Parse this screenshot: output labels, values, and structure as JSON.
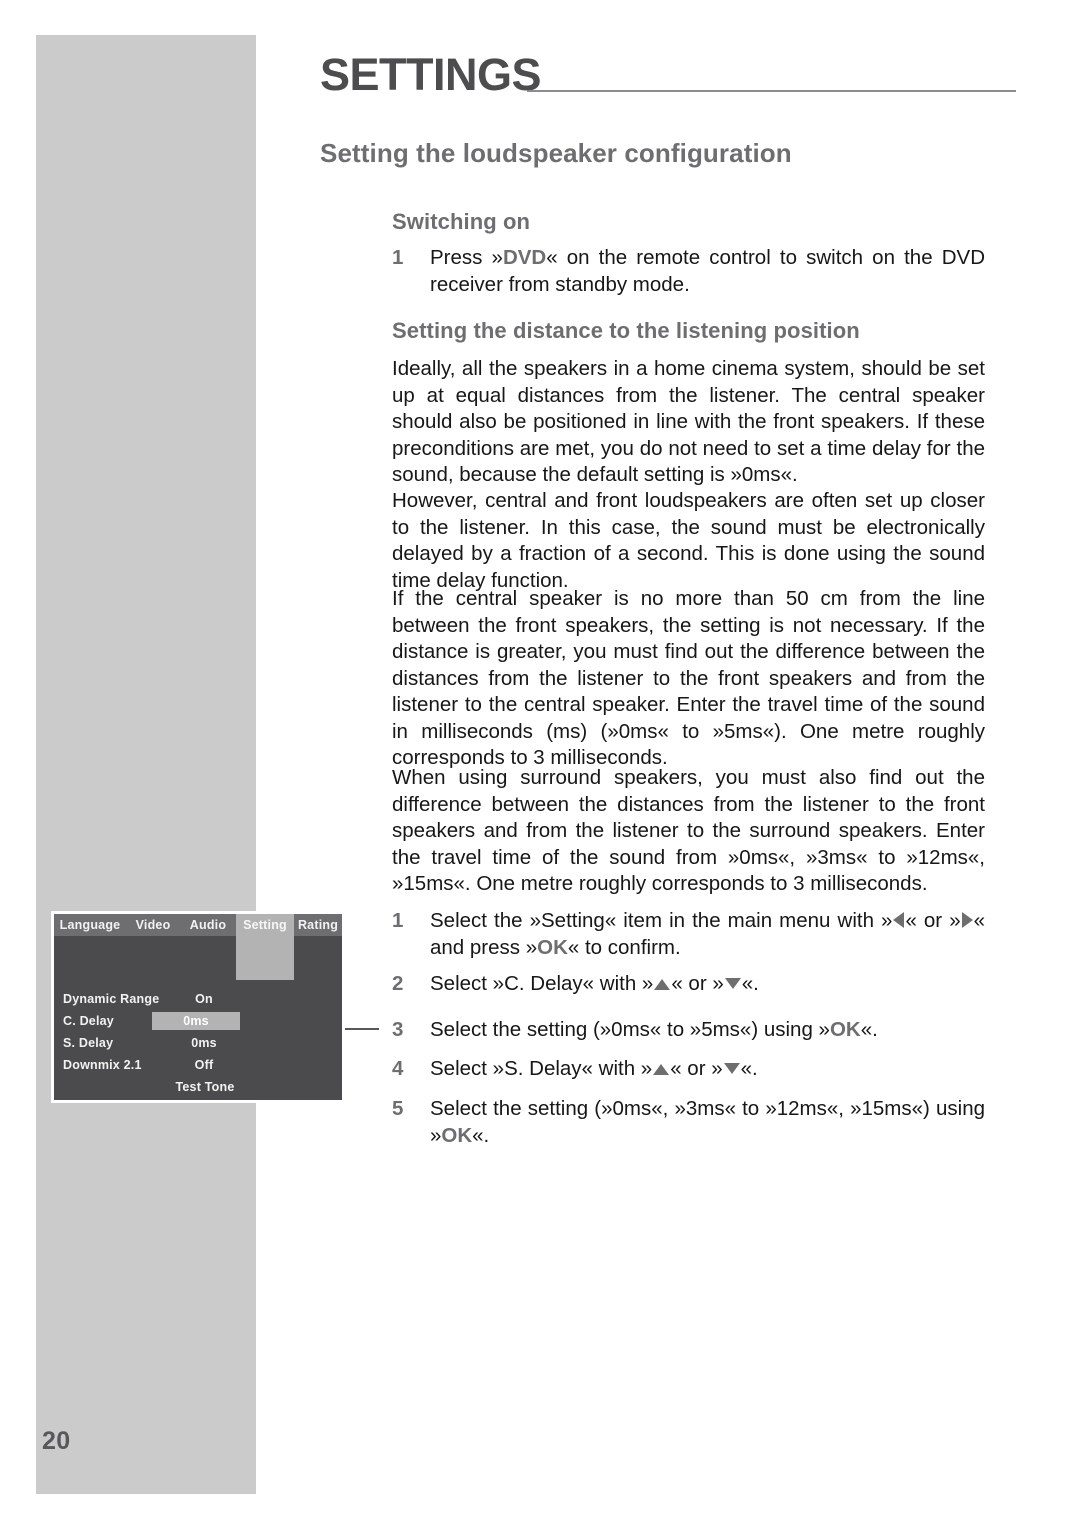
{
  "page": {
    "number": "20",
    "chapter_title": "SETTINGS",
    "section_heading": "Setting the loudspeaker configuration"
  },
  "subsections": {
    "switching_on": {
      "heading": "Switching on",
      "step_number": "1",
      "step_text_prefix": "Press »",
      "step_keyword": "DVD",
      "step_text_suffix": "« on the remote control to switch on the DVD receiver from standby mode."
    },
    "distance": {
      "heading": "Setting the distance to the listening position",
      "paragraphs": [
        "Ideally, all the speakers in a home cinema system, should be set up at equal distances from the listener. The central speaker should also be positioned in line with the front speakers. If these preconditions are met, you do not need to set a time delay for the sound, because the default setting is »0ms«.",
        "However, central and front loudspeakers are often set up closer to the listener. In this case, the sound must be electronically delayed by a fraction of a second. This is done using the sound time delay function.",
        "If the central speaker is no more than 50 cm from the line between the front speakers, the setting is not necessary. If the distance is greater, you must find out the difference between the distances from the listener to the front speakers and from the listener to the central speaker. Enter the travel time of the sound in milliseconds (ms) (»0ms« to »5ms«). One metre roughly corresponds to 3 milliseconds.",
        "When using surround speakers, you must also find out the difference between the distances from the listener to the front speakers and from the listener to the surround speakers. Enter the travel time of the sound  from »0ms«, »3ms« to »12ms«, »15ms«. One metre roughly corresponds to 3 milliseconds."
      ]
    }
  },
  "steps": [
    {
      "number": "1",
      "part1": "Select the »Setting« item in the main menu with »",
      "icon1": "left-arrow-icon",
      "part2": "« or »",
      "icon2": "right-arrow-icon",
      "part3": "« and press »",
      "keyword": "OK",
      "part4": "« to confirm."
    },
    {
      "number": "2",
      "part1": "Select »C. Delay« with »",
      "icon1": "up-arrow-icon",
      "part2": "« or »",
      "icon2": "down-arrow-icon",
      "part3": "«.",
      "keyword": "",
      "part4": ""
    },
    {
      "number": "3",
      "part1": "Select the setting (»0ms« to »5ms«) using »",
      "icon1": "",
      "part2": "",
      "icon2": "",
      "part3": "",
      "keyword": "OK",
      "part4": "«."
    },
    {
      "number": "4",
      "part1": "Select »S. Delay« with »",
      "icon1": "up-arrow-icon",
      "part2": "« or »",
      "icon2": "down-arrow-icon",
      "part3": "«.",
      "keyword": "",
      "part4": ""
    },
    {
      "number": "5",
      "part1": "Select the setting (»0ms«, »3ms« to »12ms«, »15ms«) using »",
      "icon1": "",
      "part2": "",
      "icon2": "",
      "part3": "",
      "keyword": "OK",
      "part4": "«."
    }
  ],
  "osd": {
    "tabs": [
      {
        "label": "Language",
        "selected": false
      },
      {
        "label": "Video",
        "selected": false
      },
      {
        "label": "Audio",
        "selected": false
      },
      {
        "label": "Setting",
        "selected": true
      },
      {
        "label": "Rating",
        "selected": false
      }
    ],
    "rows": [
      {
        "label": "Dynamic Range",
        "value": "On",
        "highlighted": false
      },
      {
        "label": "C. Delay",
        "value": "0ms",
        "highlighted": true
      },
      {
        "label": "S. Delay",
        "value": "0ms",
        "highlighted": false
      },
      {
        "label": "Downmix 2.1",
        "value": "Off",
        "highlighted": false
      }
    ],
    "action_label": "Test Tone"
  },
  "colors": {
    "band_gray": "#cbcbcb",
    "heading_gray": "#6e6e70",
    "title_gray": "#4d4d4f",
    "osd_background": "#4b4b4d",
    "osd_tabbar": "#6e6e70",
    "osd_highlight": "#b3b3b3",
    "body_black": "#171717"
  }
}
